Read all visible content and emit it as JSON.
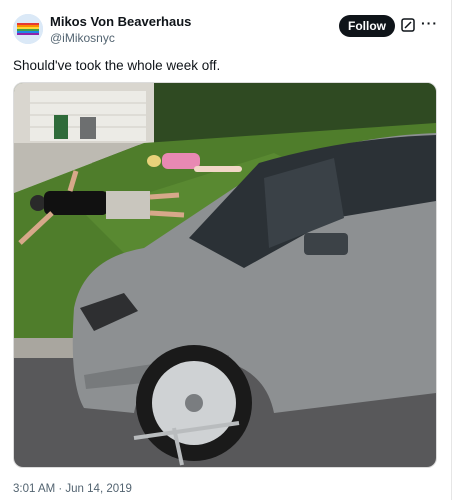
{
  "author": {
    "display_name": "Mikos Von Beaverhaus",
    "handle": "@iMikosnyc"
  },
  "actions": {
    "follow_label": "Follow",
    "grok_icon": "grok-icon",
    "more_icon": "more-icon"
  },
  "tweet": {
    "text": "Should've took the whole week off.",
    "timestamp": "3:01 AM · Jun 14, 2019"
  },
  "colors": {
    "follow_bg": "#0f1419",
    "meta_text": "#536471"
  }
}
